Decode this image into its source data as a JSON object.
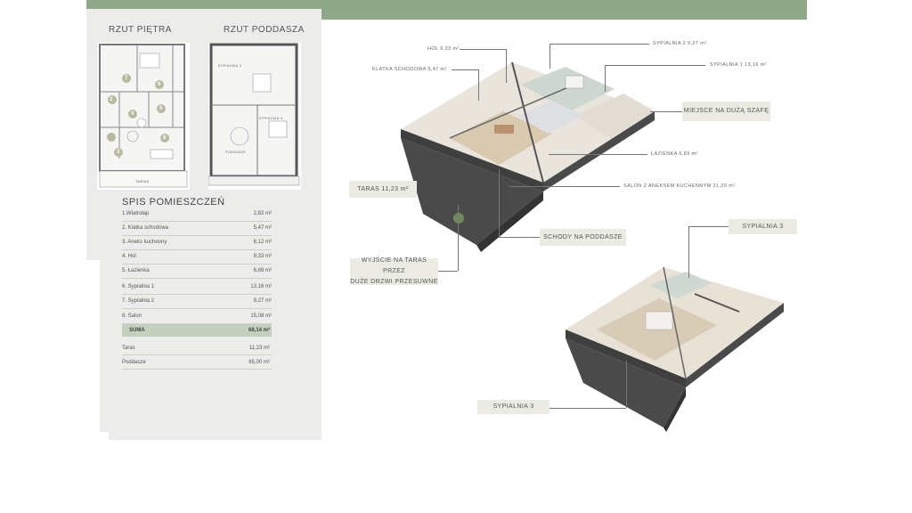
{
  "plans": {
    "floor_title": "RZUT PIĘTRA",
    "attic_title": "RZUT PODDASZA",
    "floor_terrace": "TARAS",
    "attic_labels": {
      "sypialnia2": "SYPIALNIA 2",
      "sypialnia4": "SYPIALNIA 4",
      "poddasze": "PODDASZE"
    },
    "room_numbers": [
      "1",
      "2",
      "3",
      "4",
      "5",
      "6",
      "7",
      "8"
    ]
  },
  "spis": {
    "title": "SPIS POMIESZCZEŃ",
    "rooms": [
      {
        "name": "1.Wiatrołap",
        "area": "2,82 m²"
      },
      {
        "name": "2. Klatka schodowa",
        "area": "5,47 m²"
      },
      {
        "name": "3. Aneks kuchenny",
        "area": "6,12 m²"
      },
      {
        "name": "4. Hol",
        "area": "9,33 m²"
      },
      {
        "name": "5. Łazienka",
        "area": "6,89 m²"
      },
      {
        "name": "6. Sypialnia 1",
        "area": "13,16 m²"
      },
      {
        "name": "7. Sypialnia 2",
        "area": "9,27 m²"
      },
      {
        "name": "8. Salon",
        "area": "15,08 m²"
      }
    ],
    "sum": {
      "name": "SUMA",
      "area": "68,14 m²"
    },
    "extra": [
      {
        "name": "Taras",
        "area": "11,23 m²"
      },
      {
        "name": "Poddasze",
        "area": "65,00 m²"
      }
    ]
  },
  "callouts": {
    "hol": "HOL 9,33 m²",
    "klatka": "KLATKA SCHODOWA 5,47 m²",
    "sypialnia2": "SYPIALNIA 2 9,27 m²",
    "sypialnia1": "SYPIALNIA 1 13,16 m²",
    "lazienka": "ŁAZIENKA 6,89 m²",
    "salon": "SALON Z ANEKSEM KUCHENNYM 21,20 m²"
  },
  "tags": {
    "szafa": "MIEJSCE NA DUŻĄ SZAFĘ",
    "taras": "TARAS 11,23 m²",
    "schody": "SCHODY NA PODDASZE",
    "wyjscie_line1": "WYJŚCIE NA TARAS PRZEZ",
    "wyjscie_line2": "DUŻE DRZWI PRZESUWNE",
    "sypialnia3_top": "SYPIALNIA 3",
    "sypialnia3_bottom": "SYPIALNIA 3"
  },
  "colors": {
    "accent": "#8fa88a",
    "panel": "#ececea",
    "tag": "#ecebe3",
    "sum": "#c4d0bd",
    "wall": "#4a4a4a"
  }
}
